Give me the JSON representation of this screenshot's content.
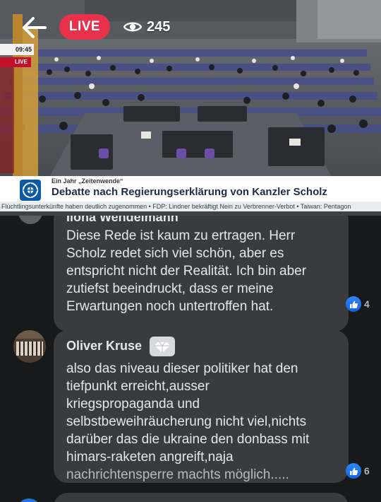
{
  "stream": {
    "live_label": "LIVE",
    "viewer_count": "245",
    "icons": {
      "back": "back-arrow-icon",
      "views": "eye-icon"
    }
  },
  "broadcast": {
    "clock": "09:45",
    "tv_live_label": "LIVE",
    "supertitle": "Ein Jahr „Zeitenwende“",
    "headline": "Debatte nach Regierungserklärung von Kanzler Scholz",
    "ticker": "Flüchtlingsunterkünfte haben deutlich zugenommen   • FDP: Lindner bekräftigt Nein zu Verbrenner-Verbot   • Taiwan: Pentagon"
  },
  "comments": [
    {
      "author": "Ilona Wendelmann",
      "lines": [
        "Diese Rede ist kaum zu ertragen. Herr",
        "Scholz redet sich viel schön, aber es",
        "entspricht nicht der Realität. Ich bin aber",
        "zutiefst beeindruckt, dass er meine",
        "Erwartungen noch untertroffen hat."
      ],
      "reactions": "4"
    },
    {
      "author": "Oliver Kruse",
      "lines": [
        "also das niveau dieser politiker hat den",
        "tiefpunkt erreicht,ausser",
        "kriegspropaganda und",
        "selbstbeweihräucherung nicht viel,nichts",
        "darüber das die ukraine den donbass mit",
        "himars-raketen angreift,naja",
        "nachrichtensperre machts möglich....."
      ],
      "reactions": "6"
    }
  ],
  "colors": {
    "live_red": "#e8314a",
    "comment_bubble": "#3a3b3c",
    "comment_bg": "#18191a",
    "like_blue": "#1877f2"
  }
}
